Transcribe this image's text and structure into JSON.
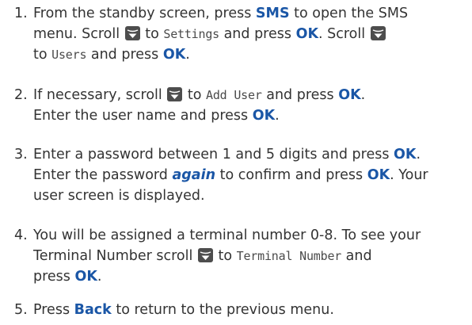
{
  "colors": {
    "keyword": "#1a56a6",
    "body_text": "#333333",
    "icon_bg": "#4d4d4d"
  },
  "icons": {
    "scroll": "scroll-key-icon"
  },
  "steps": [
    {
      "number": "1.",
      "t1": "From the standby screen, press ",
      "k1": "SMS",
      "t2": " to open the SMS",
      "t3": "menu. Scroll ",
      "t4": " to ",
      "lcd1": "Settings",
      "t5": " and press ",
      "k2": "OK",
      "t6": ". Scroll ",
      "t7": "to ",
      "lcd2": "Users",
      "t8": " and press ",
      "k3": "OK",
      "t9": "."
    },
    {
      "number": "2.",
      "t1": "If necessary, scroll ",
      "t2": " to ",
      "lcd1": "Add User",
      "t3": " and press ",
      "k1": "OK",
      "t4": ".",
      "t5": "Enter the user name and press ",
      "k2": "OK",
      "t6": "."
    },
    {
      "number": "3.",
      "t1": "Enter a password between 1 and 5 digits and press ",
      "k1": "OK",
      "t2": ".",
      "t3": "Enter the password ",
      "em1": "again",
      "t4": " to confirm and press ",
      "k2": "OK",
      "t5": ". Your",
      "t6": "user screen is displayed."
    },
    {
      "number": "4.",
      "t1": "You will be assigned a terminal number 0-8. To see your",
      "t2": "Terminal Number scroll ",
      "t3": " to ",
      "lcd1": "Terminal Number",
      "t4": " and",
      "t5": "press ",
      "k1": "OK",
      "t6": "."
    },
    {
      "number": "5.",
      "t1": "Press ",
      "k1": "Back",
      "t2": " to return to the previous menu."
    }
  ]
}
